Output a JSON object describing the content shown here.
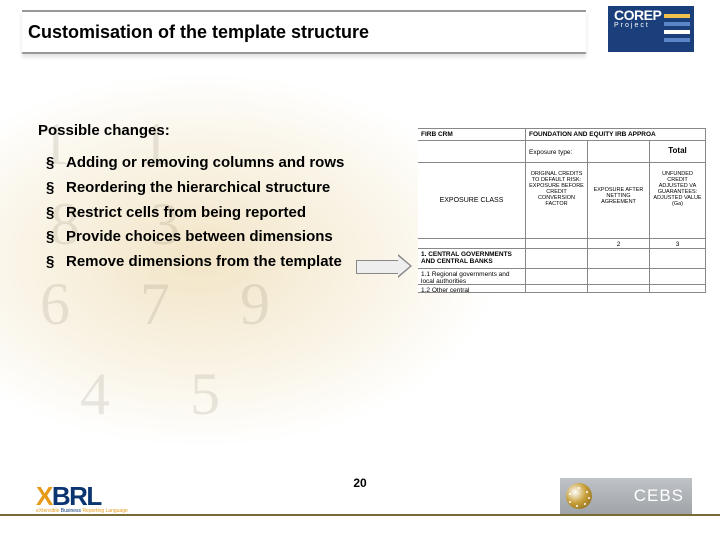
{
  "header": {
    "title": "Customisation of the template structure"
  },
  "logos": {
    "corep": {
      "line1": "COREP",
      "line2": "Project"
    },
    "xbrl": {
      "main": "XBRL",
      "tagline_pre": "eXtensible ",
      "tagline_mid": "Business ",
      "tagline_post": "Reporting Language"
    },
    "cebs": {
      "text": "CEBS"
    }
  },
  "subhead": "Possible changes:",
  "bullets": [
    "Adding or removing columns and rows",
    "Reordering the hierarchical structure",
    "Restrict cells from being reported",
    "Provide choices between dimensions",
    "Remove dimensions from the template"
  ],
  "table": {
    "title1": "FIRB CRM",
    "title2": "FOUNDATION AND EQUITY IRB APPROA",
    "exposure_type": "Exposure type:",
    "total": "Total",
    "exposure_class": "EXPOSURE CLASS",
    "col2": "ORIGINAL CREDITS TO DEFAULT RISK: EXPOSURE BEFORE CREDIT CONVERSION FACTOR",
    "col3": "EXPOSURE AFTER NETTING AGREEMENT",
    "col4": "UNFUNDED CREDIT ADJUSTED VA GUARANTEES: ADJUSTED VALUE (Ga)",
    "n2": "2",
    "n3": "3",
    "row1": "1. CENTRAL GOVERNMENTS AND CENTRAL BANKS",
    "row2": "1.1 Regional governments and local authorities",
    "row3": "1.2 Other central"
  },
  "page_number": "20",
  "ghost_numbers": [
    "1",
    "1",
    "8",
    "3",
    "6",
    "7",
    "9",
    "4",
    "5"
  ]
}
